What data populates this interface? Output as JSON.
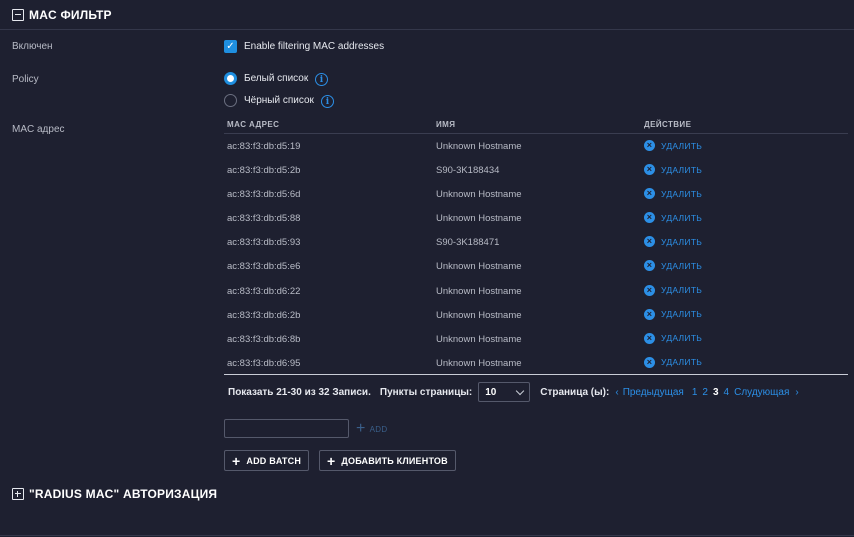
{
  "mac_filter": {
    "title": "MAC ФИЛЬТР",
    "enabled_label": "Включен",
    "enable_text": "Enable filtering MAC addresses",
    "policy_label": "Policy",
    "whitelist": "Белый список",
    "blacklist": "Чёрный список",
    "mac_label": "MAC адрес"
  },
  "table": {
    "headers": {
      "mac": "MAC АДРЕС",
      "name": "ИМЯ",
      "action": "ДЕЙСТВИЕ"
    },
    "delete_label": "УДАЛИТЬ",
    "rows": [
      {
        "mac": "ac:83:f3:db:d5:19",
        "name": "Unknown Hostname"
      },
      {
        "mac": "ac:83:f3:db:d5:2b",
        "name": "S90-3K188434"
      },
      {
        "mac": "ac:83:f3:db:d5:6d",
        "name": "Unknown Hostname"
      },
      {
        "mac": "ac:83:f3:db:d5:88",
        "name": "Unknown Hostname"
      },
      {
        "mac": "ac:83:f3:db:d5:93",
        "name": "S90-3K188471"
      },
      {
        "mac": "ac:83:f3:db:d5:e6",
        "name": "Unknown Hostname"
      },
      {
        "mac": "ac:83:f3:db:d6:22",
        "name": "Unknown Hostname"
      },
      {
        "mac": "ac:83:f3:db:d6:2b",
        "name": "Unknown Hostname"
      },
      {
        "mac": "ac:83:f3:db:d6:8b",
        "name": "Unknown Hostname"
      },
      {
        "mac": "ac:83:f3:db:d6:95",
        "name": "Unknown Hostname"
      }
    ]
  },
  "pagination": {
    "summary": "Показать 21-30 из 32 Записи.",
    "per_page_label": "Пункты страницы:",
    "per_page_value": "10",
    "page_label": "Страница (ы):",
    "prev": "Предыдущая",
    "pages": [
      "1",
      "2",
      "3",
      "4"
    ],
    "current": "3",
    "next": "Слудующая"
  },
  "actions": {
    "add": "ADD",
    "add_batch": "ADD BATCH",
    "add_clients": "ДОБАВИТЬ КЛИЕНТОВ"
  },
  "radius": {
    "title": "\"RADIUS MAC\" АВТОРИЗАЦИЯ"
  },
  "colors": {
    "background": "#1e2030",
    "accent": "#1f8fe0",
    "text": "#c9ccd6"
  }
}
